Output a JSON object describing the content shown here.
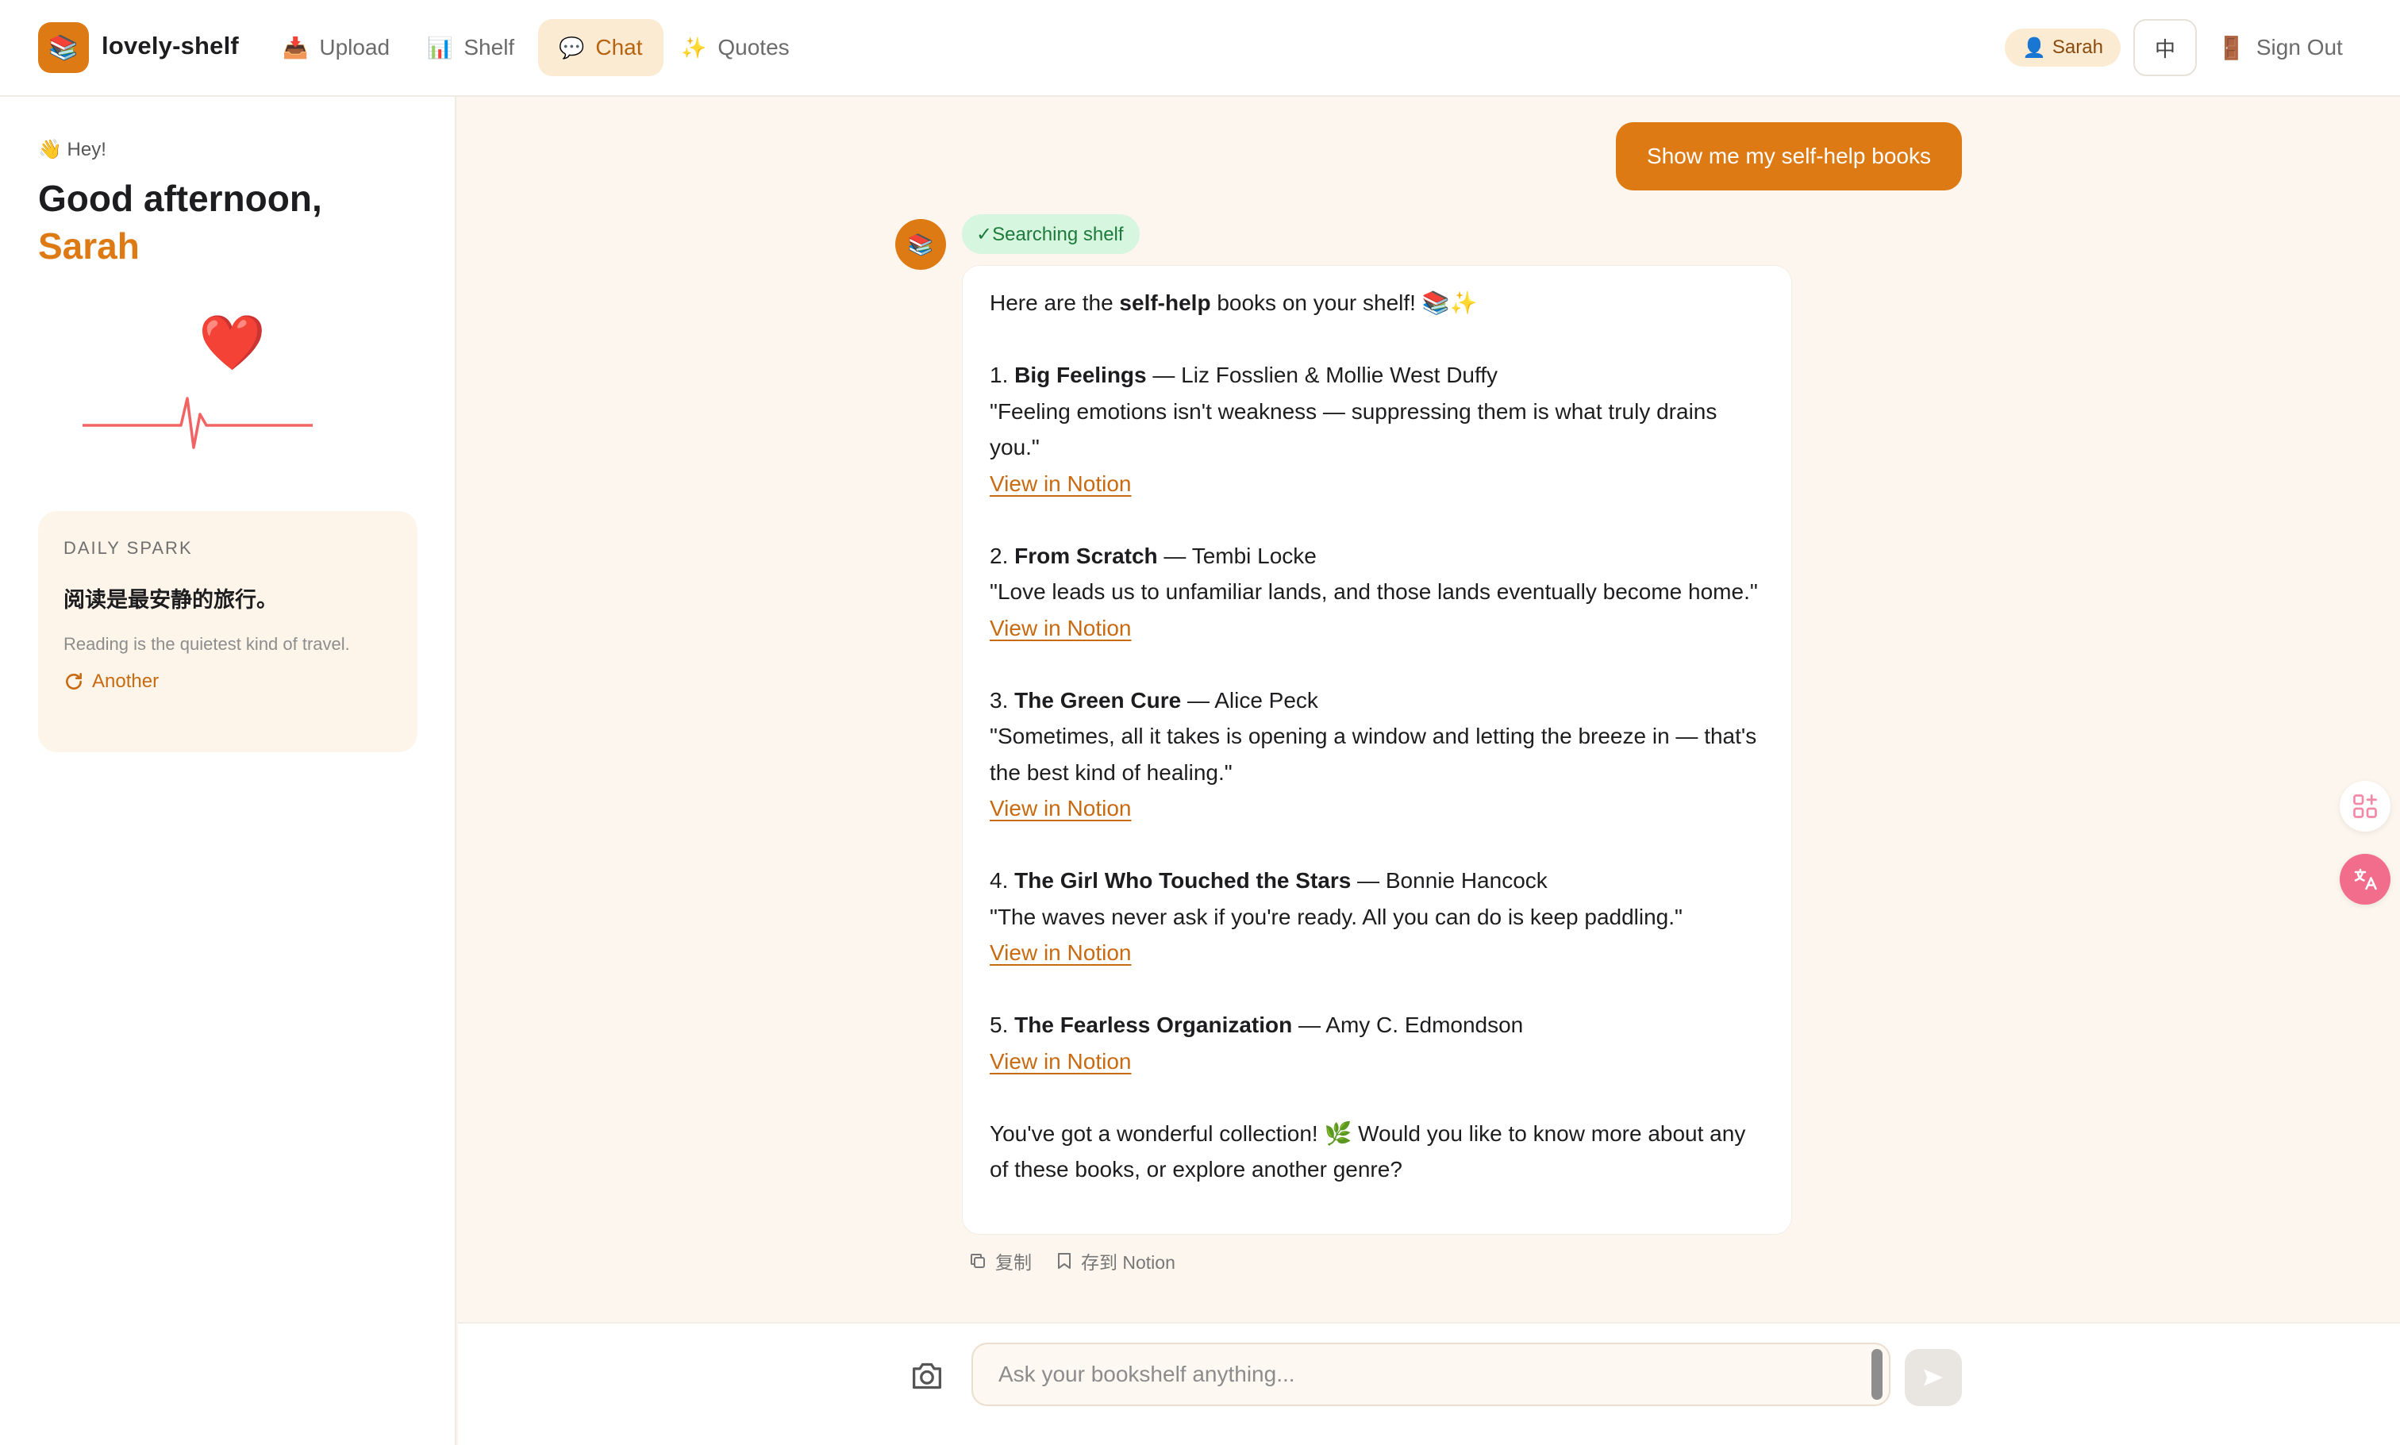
{
  "app": {
    "logo_glyph": "📚",
    "brand": "lovely-shelf"
  },
  "nav": {
    "items": [
      {
        "icon": "📥",
        "label": "Upload"
      },
      {
        "icon": "📊",
        "label": "Shelf"
      },
      {
        "icon": "💬",
        "label": "Chat"
      },
      {
        "icon": "✨",
        "label": "Quotes"
      }
    ],
    "active": "Chat",
    "user": {
      "icon": "👤",
      "name": "Sarah"
    },
    "lang_toggle": "中",
    "signout": {
      "icon": "🚪",
      "label": "Sign Out"
    }
  },
  "sidebar": {
    "hey": "👋 Hey!",
    "greeting": "Good afternoon,",
    "name": "Sarah",
    "heart": "❤️",
    "spark": {
      "title": "DAILY SPARK",
      "quote_cn": "阅读是最安静的旅行。",
      "quote_en": "Reading is the quietest kind of travel.",
      "another": "Another"
    }
  },
  "chat": {
    "user_message": "Show me my self-help books",
    "bot_avatar": "📚",
    "status": "✓Searching shelf",
    "intro_pre": "Here are the ",
    "intro_bold": "self-help",
    "intro_post": " books on your shelf! 📚✨",
    "books": [
      {
        "num": "1. ",
        "title": "Big Feelings",
        "author": " — Liz Fosslien & Mollie West Duffy",
        "quote": "\"Feeling emotions isn't weakness — suppressing them is what truly drains you.\"",
        "link": "View in Notion"
      },
      {
        "num": "2. ",
        "title": "From Scratch",
        "author": " — Tembi Locke",
        "quote": "\"Love leads us to unfamiliar lands, and those lands eventually become home.\"",
        "link": "View in Notion"
      },
      {
        "num": "3. ",
        "title": "The Green Cure",
        "author": " — Alice Peck",
        "quote": "\"Sometimes, all it takes is opening a window and letting the breeze in — that's the best kind of healing.\"",
        "link": "View in Notion"
      },
      {
        "num": "4. ",
        "title": "The Girl Who Touched the Stars",
        "author": " — Bonnie Hancock",
        "quote": "\"The waves never ask if you're ready. All you can do is keep paddling.\"",
        "link": "View in Notion"
      },
      {
        "num": "5. ",
        "title": "The Fearless Organization",
        "author": " — Amy C. Edmondson",
        "quote": "",
        "link": "View in Notion"
      }
    ],
    "outro": "You've got a wonderful collection! 🌿 Would you like to know more about any of these books, or explore another genre?",
    "actions": {
      "copy": "复制",
      "save": "存到 Notion"
    }
  },
  "composer": {
    "placeholder": "Ask your bookshelf anything...",
    "value": ""
  },
  "colors": {
    "accent": "#dd7a14",
    "accent_soft": "#fcebd3",
    "status_bg": "#d7f6e0",
    "status_fg": "#1d7a3a",
    "pulse": "#f26363",
    "page_bg": "#fdf6ee"
  }
}
